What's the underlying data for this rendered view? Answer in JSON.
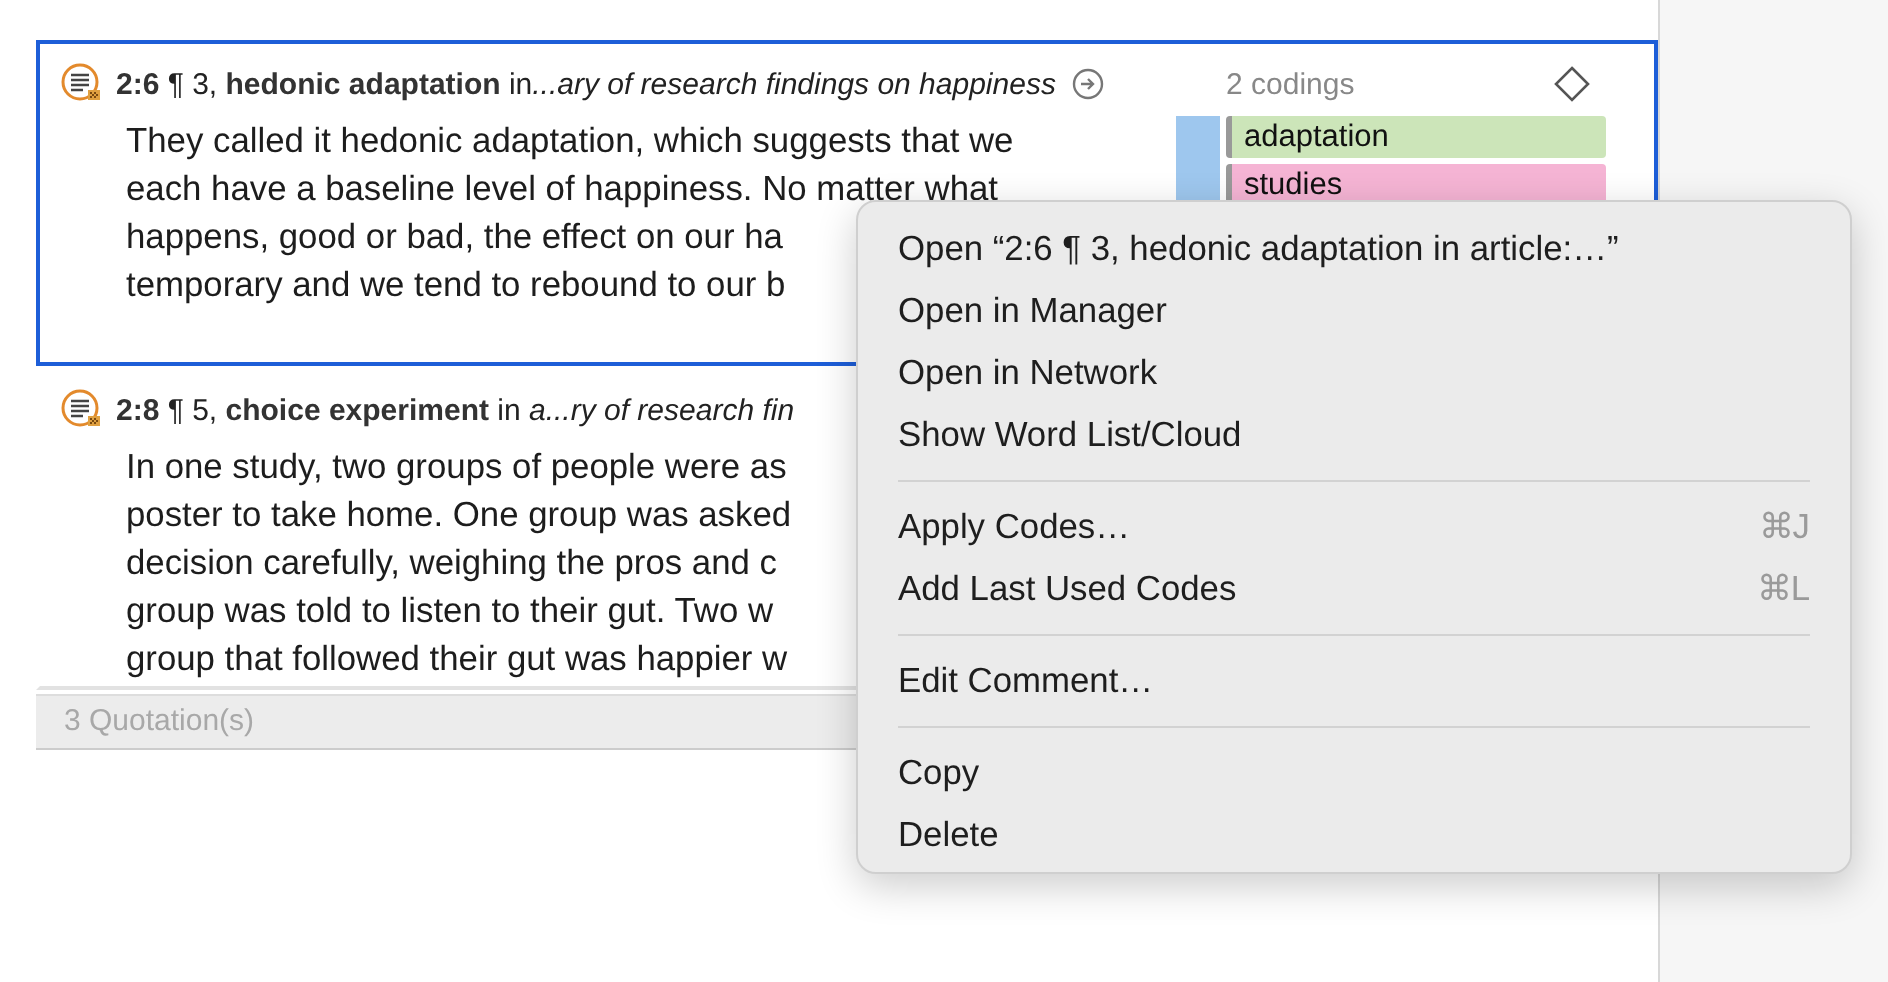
{
  "quotations": [
    {
      "selected": true,
      "header": "**2:6** ¶ 3, **hedonic adaptation** in",
      "source": "...ary of research findings on happiness",
      "lines": [
        "They called it hedonic adaptation, which suggests that we",
        "each have a baseline level of happiness. No matter what",
        "happens, good or bad, the effect on our ha",
        "temporary and we tend to rebound to our b"
      ],
      "codings_count": "2 codings",
      "codes": [
        {
          "label": "adaptation",
          "color": "#cce5b9"
        },
        {
          "label": "studies",
          "color": "#f5b4d4"
        }
      ]
    },
    {
      "selected": false,
      "header": "**2:8** ¶ 5, **choice experiment** in ",
      "source": "a...ry of research fin",
      "lines": [
        "In one study, two groups of people were as",
        "poster to take home. One group was asked",
        "decision carefully, weighing the pros and c",
        "group was told to listen to their gut. Two w",
        "group that followed their gut was happier w"
      ]
    }
  ],
  "footer": "3 Quotation(s)",
  "context_menu": {
    "groups": [
      [
        {
          "label": "Open “2:6 ¶ 3, hedonic adaptation in article:…”"
        },
        {
          "label": "Open in Manager"
        },
        {
          "label": "Open in Network"
        },
        {
          "label": "Show Word List/Cloud"
        }
      ],
      [
        {
          "label": "Apply Codes…",
          "shortcut": "⌘J"
        },
        {
          "label": "Add Last Used Codes",
          "shortcut": "⌘L"
        }
      ],
      [
        {
          "label": "Edit Comment…"
        }
      ],
      [
        {
          "label": "Copy"
        },
        {
          "label": "Delete"
        }
      ]
    ]
  }
}
